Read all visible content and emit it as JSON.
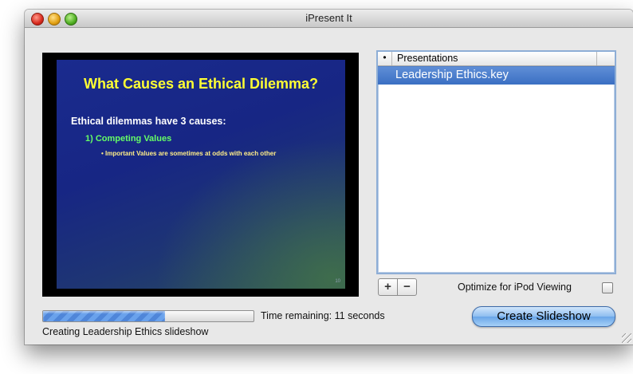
{
  "window": {
    "title": "iPresent It"
  },
  "slide": {
    "title": "What Causes an Ethical Dilemma?",
    "heading": "Ethical dilemmas have 3 causes:",
    "item": "1)  Competing Values",
    "bullet": "• Important Values are sometimes at odds with each other",
    "page_number": "10"
  },
  "presentations": {
    "column_marker": "•",
    "column_header": "Presentations",
    "items": [
      "Leadership Ethics.key"
    ],
    "selected_index": 0
  },
  "list_controls": {
    "add_label": "+",
    "remove_label": "−"
  },
  "options": {
    "optimize_label": "Optimize for iPod Viewing",
    "optimize_checked": false
  },
  "progress": {
    "fraction": 0.58,
    "time_remaining": "Time remaining: 11 seconds",
    "status": "Creating Leadership Ethics slideshow"
  },
  "actions": {
    "create_label": "Create Slideshow"
  },
  "colors": {
    "slide_title": "#ffff33",
    "slide_item": "#66ff66",
    "selection": "#3a6fc3",
    "progress_fill": "#4f86d9"
  }
}
